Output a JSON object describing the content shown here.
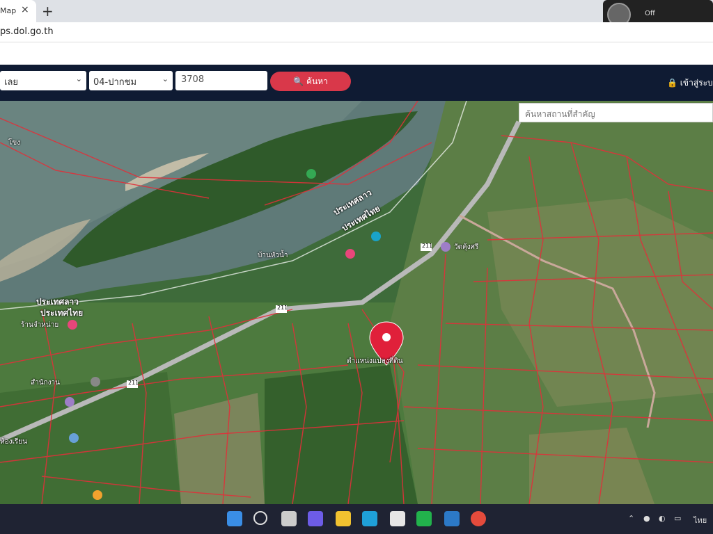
{
  "browser": {
    "tab_title": "Map",
    "tab_close": "×",
    "new_tab": "+",
    "url": "ps.dol.go.th"
  },
  "recorder": {
    "status": "Off"
  },
  "navbar": {
    "province": "เลย",
    "district": "04-ปากชม",
    "parcel_no": "3708",
    "search_label": "ค้นหา",
    "login_label": "เข้าสู่ระบบ"
  },
  "map": {
    "search_placeholder": "ค้นหาสถานที่สำคัญ",
    "labels": {
      "river": "โขง",
      "border1": "ประเทศลาว",
      "border2": "ประเทศไทย",
      "border3": "ประเทศลาว",
      "border4": "ประเทศไทย",
      "marker_label": "ตำแหน่งแปลงที่ดิน",
      "road_211": "211",
      "road_211b": "211",
      "road_211c": "211",
      "tax_point": "ร้านจำหน่าย",
      "temple": "วัดคุ้งศรี",
      "office": "สำนักงาน",
      "school": "ห้องเรียน",
      "house": "บ้านหัวน้ำ"
    }
  },
  "taskbar": {
    "lang": "ไทย"
  }
}
